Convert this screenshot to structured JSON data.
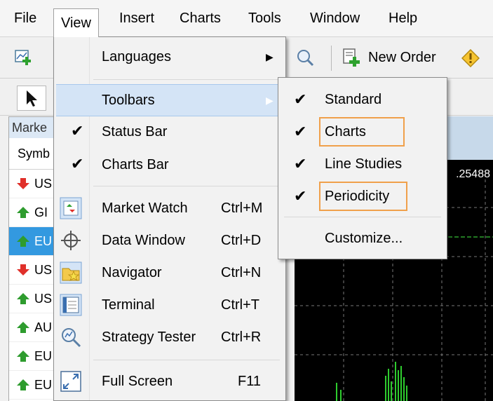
{
  "menubar": {
    "items": [
      "File",
      "View",
      "Insert",
      "Charts",
      "Tools",
      "Window",
      "Help"
    ]
  },
  "toolbar": {
    "new_order_label": "New Order"
  },
  "market_watch": {
    "title": "Marke",
    "column_header": "Symb",
    "rows": [
      {
        "symbol": "US",
        "direction": "down"
      },
      {
        "symbol": "GI",
        "direction": "up"
      },
      {
        "symbol": "EU",
        "direction": "up",
        "selected": true
      },
      {
        "symbol": "US",
        "direction": "down"
      },
      {
        "symbol": "US",
        "direction": "up"
      },
      {
        "symbol": "AU",
        "direction": "up"
      },
      {
        "symbol": "EU",
        "direction": "up"
      },
      {
        "symbol": "EU",
        "direction": "up"
      }
    ]
  },
  "chart": {
    "price_label": ".25488"
  },
  "view_menu": {
    "items": [
      {
        "label": "Languages",
        "shortcut": "",
        "submenu": true
      },
      {
        "label": "Toolbars",
        "shortcut": "",
        "submenu": true,
        "highlighted": true
      },
      {
        "label": "Status Bar",
        "shortcut": "",
        "checked": true
      },
      {
        "label": "Charts Bar",
        "shortcut": "",
        "checked": true
      },
      {
        "label": "Market Watch",
        "shortcut": "Ctrl+M",
        "icon": "market-watch-icon"
      },
      {
        "label": "Data Window",
        "shortcut": "Ctrl+D",
        "icon": "crosshair-icon"
      },
      {
        "label": "Navigator",
        "shortcut": "Ctrl+N",
        "icon": "navigator-icon"
      },
      {
        "label": "Terminal",
        "shortcut": "Ctrl+T",
        "icon": "terminal-icon"
      },
      {
        "label": "Strategy Tester",
        "shortcut": "Ctrl+R",
        "icon": "strategy-tester-icon"
      },
      {
        "label": "Full Screen",
        "shortcut": "F11",
        "icon": "fullscreen-icon"
      }
    ]
  },
  "toolbars_submenu": {
    "items": [
      {
        "label": "Standard",
        "checked": true
      },
      {
        "label": "Charts",
        "checked": true,
        "boxed": true
      },
      {
        "label": "Line Studies",
        "checked": true
      },
      {
        "label": "Periodicity",
        "checked": true,
        "boxed": true
      },
      {
        "label": "Customize...",
        "checked": false
      }
    ]
  },
  "colors": {
    "highlight_box": "#f0a04b",
    "menu_highlight": "#d4e4f6",
    "selected_row": "#3399e0",
    "chart_bg": "#000000",
    "arrow_up": "#2e9c2e",
    "arrow_down": "#e0302a"
  }
}
